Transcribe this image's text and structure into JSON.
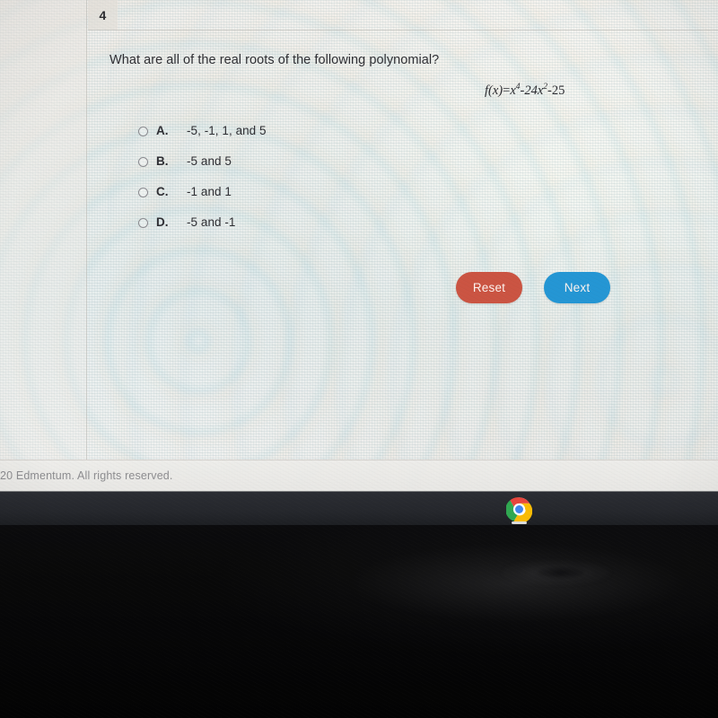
{
  "assessment": {
    "question_number": "4",
    "question_text": "What are all of the real roots of the following polynomial?",
    "equation": {
      "function_name": "f(x)",
      "equals": "=",
      "term1_base": "x",
      "term1_exp": "4",
      "op1": "-",
      "term2_coef": "24x",
      "term2_exp": "2",
      "op2": "-",
      "term3": "25",
      "plain": "f(x) = x4 - 24x2 - 25"
    },
    "options": [
      {
        "letter": "A.",
        "text": "-5, -1, 1, and 5",
        "selected": false
      },
      {
        "letter": "B.",
        "text": "-5 and 5",
        "selected": false
      },
      {
        "letter": "C.",
        "text": "-1 and 1",
        "selected": false
      },
      {
        "letter": "D.",
        "text": "-5 and -1",
        "selected": false
      }
    ],
    "buttons": {
      "reset_label": "Reset",
      "next_label": "Next"
    }
  },
  "footer": {
    "copyright": "20 Edmentum. All rights reserved."
  },
  "shelf": {
    "launcher_icon": "chrome-icon"
  },
  "colors": {
    "reset_button": "#cb5442",
    "next_button": "#2496d4",
    "text": "#2e2e33",
    "footer_text": "#8d8d90",
    "shelf": "#25272c"
  }
}
